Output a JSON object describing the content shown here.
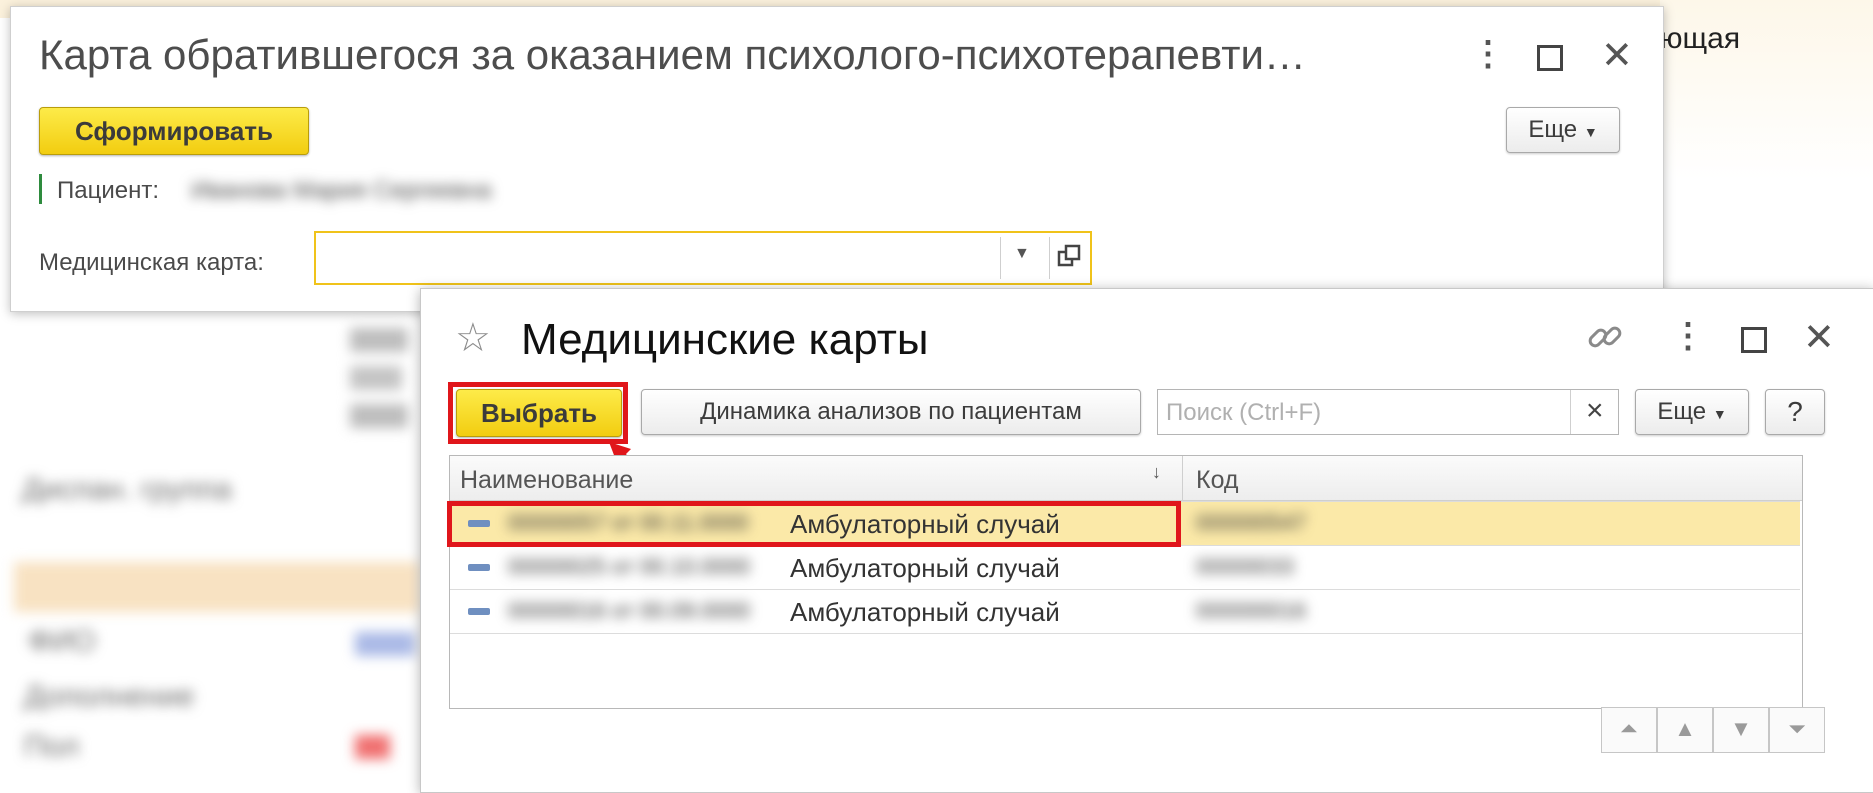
{
  "background": {
    "partial_word": "ющая",
    "blurred_labels": [
      "Диспан. группа",
      "ФИО",
      "Дополнение",
      "Пол"
    ],
    "highlight_color": "#f8e2c2"
  },
  "dialog1": {
    "title": "Карта обратившегося за оказанием психолого-психотерапевти…",
    "menu_icon": "more-vertical-icon",
    "form_button": "Сформировать",
    "more_button": "Еще",
    "patient_label": "Пациент:",
    "patient_value": "Иванова Мария Сергеевна",
    "medcard_label": "Медицинская карта:",
    "medcard_value": ""
  },
  "dialog2": {
    "title": "Медицинские карты",
    "select_button": "Выбрать",
    "dynamics_button": "Динамика анализов по пациентам",
    "search_placeholder": "Поиск (Ctrl+F)",
    "clear_label": "×",
    "more_button": "Еще",
    "help_button": "?",
    "columns": {
      "name": "Наименование",
      "sort": "↓",
      "code": "Код"
    },
    "rows": [
      {
        "prefix": "00000057 от 00.11.0000",
        "name": "Амбулаторный случай",
        "code": "000000547",
        "selected": true
      },
      {
        "prefix": "00000025 от 00.10.0000",
        "name": "Амбулаторный случай",
        "code": "00000033",
        "selected": false
      },
      {
        "prefix": "00000016 от 00.09.0000",
        "name": "Амбулаторный случай",
        "code": "000000016",
        "selected": false
      }
    ]
  },
  "colors": {
    "accent_yellow": "#f6d92a",
    "selected_row": "#fbe9a8",
    "annotation_red": "#e0161b"
  }
}
